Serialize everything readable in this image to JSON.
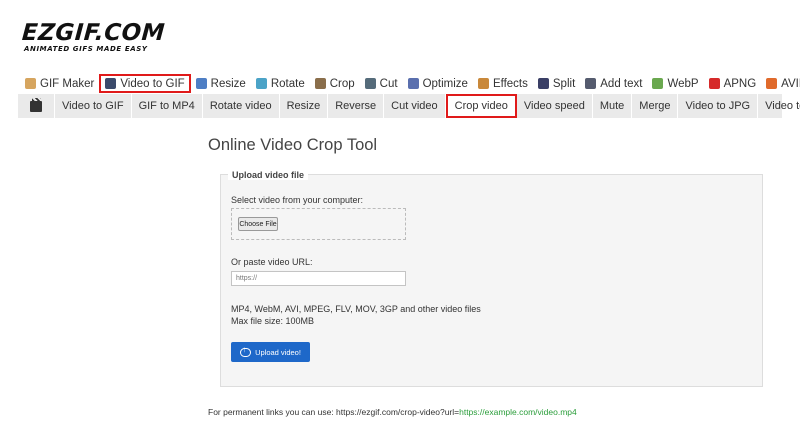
{
  "logo": {
    "main": "EZGIF.COM",
    "tagline": "ANIMATED GIFS MADE EASY"
  },
  "topnav": [
    {
      "label": "GIF Maker",
      "icon": "gif-maker-icon",
      "color": "#d6a55f",
      "active": false
    },
    {
      "label": "Video to GIF",
      "icon": "video-to-gif-icon",
      "color": "#3b4a6b",
      "active": true
    },
    {
      "label": "Resize",
      "icon": "resize-icon",
      "color": "#4e7ec4",
      "active": false
    },
    {
      "label": "Rotate",
      "icon": "rotate-icon",
      "color": "#4ba3c7",
      "active": false
    },
    {
      "label": "Crop",
      "icon": "crop-icon",
      "color": "#8a6e4b",
      "active": false
    },
    {
      "label": "Cut",
      "icon": "cut-icon",
      "color": "#556b7a",
      "active": false
    },
    {
      "label": "Optimize",
      "icon": "optimize-icon",
      "color": "#5a6fae",
      "active": false
    },
    {
      "label": "Effects",
      "icon": "effects-icon",
      "color": "#c9883a",
      "active": false
    },
    {
      "label": "Split",
      "icon": "split-icon",
      "color": "#3a3f66",
      "active": false
    },
    {
      "label": "Add text",
      "icon": "add-text-icon",
      "color": "#555b6e",
      "active": false
    },
    {
      "label": "WebP",
      "icon": "webp-icon",
      "color": "#6aa84f",
      "active": false
    },
    {
      "label": "APNG",
      "icon": "apng-icon",
      "color": "#d62a2a",
      "active": false
    },
    {
      "label": "AVIF",
      "icon": "avif-icon",
      "color": "#e06a2b",
      "active": false
    }
  ],
  "subnav": [
    {
      "label": "Video to GIF",
      "active": false
    },
    {
      "label": "GIF to MP4",
      "active": false
    },
    {
      "label": "Rotate video",
      "active": false
    },
    {
      "label": "Resize",
      "active": false
    },
    {
      "label": "Reverse",
      "active": false
    },
    {
      "label": "Cut video",
      "active": false
    },
    {
      "label": "Crop video",
      "active": true
    },
    {
      "label": "Video speed",
      "active": false
    },
    {
      "label": "Mute",
      "active": false
    },
    {
      "label": "Merge",
      "active": false
    },
    {
      "label": "Video to JPG",
      "active": false
    },
    {
      "label": "Video to PNG",
      "active": false
    }
  ],
  "page": {
    "title": "Online Video Crop Tool"
  },
  "upload": {
    "legend": "Upload video file",
    "select_label": "Select video from your computer:",
    "choose_button": "Choose File",
    "url_label": "Or paste video URL:",
    "url_placeholder": "https://",
    "formats_line": "MP4, WebM, AVI, MPEG, FLV, MOV, 3GP and other video files",
    "max_size_line": "Max file size: 100MB",
    "upload_button": "Upload video!"
  },
  "footer": {
    "prefix": "For permanent links you can use: https://ezgif.com/crop-video?url=",
    "example_url": "https://example.com/video.mp4"
  }
}
